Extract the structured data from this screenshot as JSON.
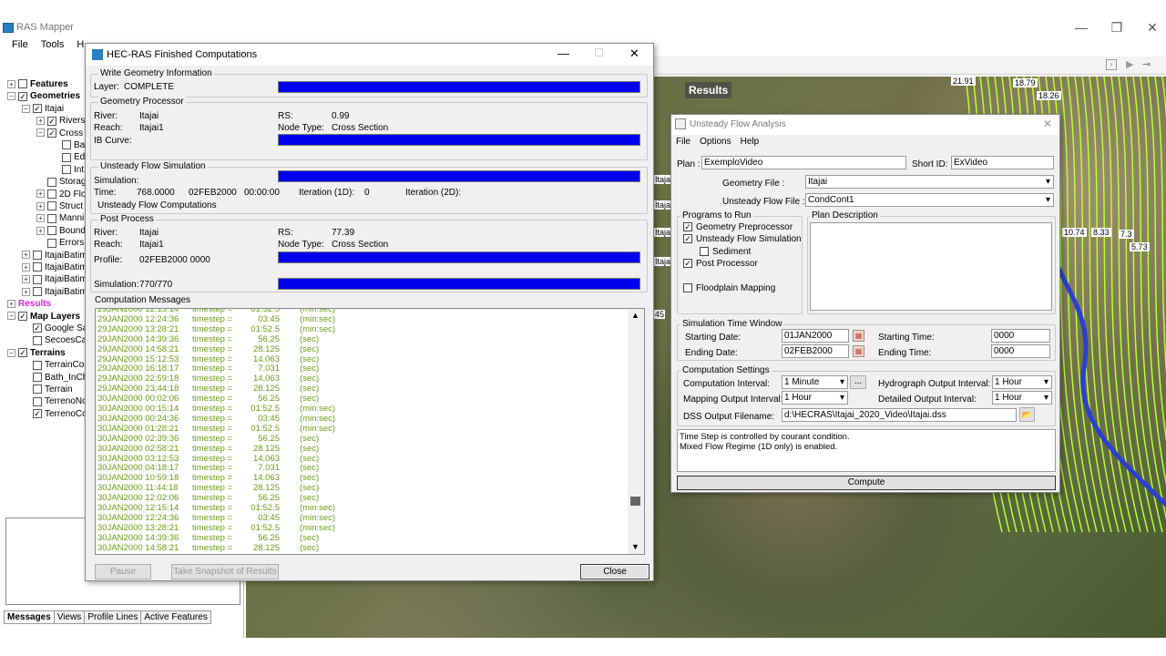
{
  "app": {
    "title": "RAS Mapper",
    "menu": [
      "File",
      "Tools",
      "H"
    ]
  },
  "tree": [
    {
      "label": "Features",
      "bold": true,
      "checked": false,
      "exp": "+",
      "indent": 0
    },
    {
      "label": "Geometries",
      "bold": true,
      "checked": true,
      "exp": "−",
      "indent": 0
    },
    {
      "label": "Itajai",
      "checked": true,
      "exp": "−",
      "indent": 1
    },
    {
      "label": "Rivers",
      "checked": true,
      "exp": "+",
      "indent": 2
    },
    {
      "label": "Cross",
      "checked": true,
      "exp": "−",
      "indent": 2
    },
    {
      "label": "Ba",
      "checked": false,
      "indent": 3
    },
    {
      "label": "Ed",
      "checked": false,
      "indent": 3
    },
    {
      "label": "Int",
      "checked": false,
      "indent": 3
    },
    {
      "label": "Storag",
      "checked": false,
      "indent": 2
    },
    {
      "label": "2D Flo",
      "checked": false,
      "exp": "+",
      "indent": 2
    },
    {
      "label": "Struct",
      "checked": false,
      "exp": "+",
      "indent": 2
    },
    {
      "label": "Manni",
      "checked": false,
      "exp": "+",
      "indent": 2
    },
    {
      "label": "Bound",
      "checked": false,
      "exp": "+",
      "indent": 2
    },
    {
      "label": "Errors",
      "checked": false,
      "indent": 2
    },
    {
      "label": "ItajaiBatim",
      "checked": false,
      "exp": "+",
      "indent": 1
    },
    {
      "label": "ItajaiBatim",
      "checked": false,
      "exp": "+",
      "indent": 1
    },
    {
      "label": "ItajaiBatim",
      "checked": false,
      "exp": "+",
      "indent": 1
    },
    {
      "label": "ItajaiBatim",
      "checked": false,
      "exp": "+",
      "indent": 1
    },
    {
      "label": "Results",
      "bold": true,
      "magenta": true,
      "exp": "+",
      "indent": 0
    },
    {
      "label": "Map Layers",
      "bold": true,
      "checked": true,
      "exp": "−",
      "indent": 0
    },
    {
      "label": "Google Sa",
      "checked": true,
      "indent": 1
    },
    {
      "label": "SecoesCa",
      "checked": false,
      "indent": 1
    },
    {
      "label": "Terrains",
      "bold": true,
      "checked": true,
      "exp": "−",
      "indent": 0
    },
    {
      "label": "TerrainCo",
      "checked": false,
      "indent": 1
    },
    {
      "label": "Bath_InCh",
      "checked": false,
      "indent": 1
    },
    {
      "label": "Terrain",
      "checked": false,
      "indent": 1
    },
    {
      "label": "TerrenoNo",
      "checked": false,
      "indent": 1
    },
    {
      "label": "TerrenoCo",
      "checked": true,
      "indent": 1
    }
  ],
  "bottom_tabs": [
    "Messages",
    "Views",
    "Profile Lines",
    "Active Features"
  ],
  "map": {
    "results_label": "Results",
    "numbers": [
      "21.91",
      "18.79",
      "18.26",
      "10.74",
      "8.33",
      "7.3",
      "5.73",
      "15.4"
    ],
    "side_labels": [
      "Itajai.p",
      "Itajai.p",
      "Itajai.p",
      "Itajai.c"
    ],
    "scroll_marker": "45"
  },
  "comp": {
    "title": "HEC-RAS Finished Computations",
    "wgi": {
      "group": "Write Geometry Information",
      "layer_lbl": "Layer:",
      "layer_val": "COMPLETE"
    },
    "gp": {
      "group": "Geometry Processor",
      "river_lbl": "River:",
      "river_val": "Itajai",
      "reach_lbl": "Reach:",
      "reach_val": "Itajai1",
      "rs_lbl": "RS:",
      "rs_val": "0.99",
      "nt_lbl": "Node Type:",
      "nt_val": "Cross Section",
      "ib_lbl": "IB Curve:"
    },
    "ufs": {
      "group": "Unsteady Flow Simulation",
      "sim_lbl": "Simulation:",
      "time_lbl": "Time:",
      "time_val": "768.0000",
      "date_val": "02FEB2000",
      "clock_val": "00:00:00",
      "iter1_lbl": "Iteration (1D):",
      "iter1_val": "0",
      "iter2_lbl": "Iteration (2D):",
      "status": "Unsteady Flow Computations"
    },
    "pp": {
      "group": "Post Process",
      "river_lbl": "River:",
      "river_val": "Itajai",
      "reach_lbl": "Reach:",
      "reach_val": "Itajai1",
      "rs_lbl": "RS:",
      "rs_val": "77.39",
      "nt_lbl": "Node Type:",
      "nt_val": "Cross Section",
      "profile_lbl": "Profile:",
      "profile_val": "02FEB2000 0000",
      "sim_lbl": "Simulation:",
      "sim_val": "770/770"
    },
    "msgs_group": "Computation Messages",
    "messages": [
      [
        "29JAN2000 12:13:14",
        "timestep =",
        "01:52.5",
        "(min:sec)"
      ],
      [
        "29JAN2000 12:24:36",
        "timestep =",
        "03:45",
        "(min:sec)"
      ],
      [
        "29JAN2000 13:28:21",
        "timestep =",
        "01:52.5",
        "(min:sec)"
      ],
      [
        "29JAN2000 14:39:36",
        "timestep =",
        "56.25",
        "(sec)"
      ],
      [
        "29JAN2000 14:58:21",
        "timestep =",
        "28.125",
        "(sec)"
      ],
      [
        "29JAN2000 15:12:53",
        "timestep =",
        "14.063",
        "(sec)"
      ],
      [
        "29JAN2000 16:18:17",
        "timestep =",
        "7.031",
        "(sec)"
      ],
      [
        "29JAN2000 22:59:18",
        "timestep =",
        "14.063",
        "(sec)"
      ],
      [
        "29JAN2000 23:44:18",
        "timestep =",
        "28.125",
        "(sec)"
      ],
      [
        "30JAN2000 00:02:06",
        "timestep =",
        "56.25",
        "(sec)"
      ],
      [
        "30JAN2000 00:15:14",
        "timestep =",
        "01:52.5",
        "(min:sec)"
      ],
      [
        "30JAN2000 00:24:36",
        "timestep =",
        "03:45",
        "(min:sec)"
      ],
      [
        "30JAN2000 01:28:21",
        "timestep =",
        "01:52.5",
        "(min:sec)"
      ],
      [
        "30JAN2000 02:39:36",
        "timestep =",
        "56.25",
        "(sec)"
      ],
      [
        "30JAN2000 02:58:21",
        "timestep =",
        "28.125",
        "(sec)"
      ],
      [
        "30JAN2000 03:12:53",
        "timestep =",
        "14.063",
        "(sec)"
      ],
      [
        "30JAN2000 04:18:17",
        "timestep =",
        "7.031",
        "(sec)"
      ],
      [
        "30JAN2000 10:59:18",
        "timestep =",
        "14.063",
        "(sec)"
      ],
      [
        "30JAN2000 11:44:18",
        "timestep =",
        "28.125",
        "(sec)"
      ],
      [
        "30JAN2000 12:02:06",
        "timestep =",
        "56.25",
        "(sec)"
      ],
      [
        "30JAN2000 12:15:14",
        "timestep =",
        "01:52.5",
        "(min:sec)"
      ],
      [
        "30JAN2000 12:24:36",
        "timestep =",
        "03:45",
        "(min:sec)"
      ],
      [
        "30JAN2000 13:28:21",
        "timestep =",
        "01:52.5",
        "(min:sec)"
      ],
      [
        "30JAN2000 14:39:36",
        "timestep =",
        "56.25",
        "(sec)"
      ],
      [
        "30JAN2000 14:58:21",
        "timestep =",
        "28.125",
        "(sec)"
      ]
    ],
    "pause": "Pause",
    "snapshot": "Take Snapshot of Results",
    "close": "Close"
  },
  "usf": {
    "title": "Unsteady Flow Analysis",
    "menu": [
      "File",
      "Options",
      "Help"
    ],
    "plan_lbl": "Plan :",
    "plan_val": "ExemploVideo",
    "short_lbl": "Short ID:",
    "short_val": "ExVideo",
    "geom_lbl": "Geometry File :",
    "geom_val": "Itajai",
    "flow_lbl": "Unsteady Flow File :",
    "flow_val": "CondCont1",
    "programs_group": "Programs to Run",
    "p1": "Geometry Preprocessor",
    "p2": "Unsteady Flow Simulation",
    "p3": "Sediment",
    "p4": "Post Processor",
    "p5": "Floodplain Mapping",
    "desc_group": "Plan Description",
    "stw_group": "Simulation Time Window",
    "sd_lbl": "Starting Date:",
    "sd_val": "01JAN2000",
    "ed_lbl": "Ending Date:",
    "ed_val": "02FEB2000",
    "st_lbl": "Starting Time:",
    "st_val": "0000",
    "et_lbl": "Ending Time:",
    "et_val": "0000",
    "cs_group": "Computation Settings",
    "ci_lbl": "Computation Interval:",
    "ci_val": "1 Minute",
    "hoi_lbl": "Hydrograph Output Interval:",
    "hoi_val": "1 Hour",
    "moi_lbl": "Mapping Output Interval:",
    "moi_val": "1 Hour",
    "doi_lbl": "Detailed Output Interval:",
    "doi_val": "1 Hour",
    "dss_lbl": "DSS Output Filename:",
    "dss_val": "d:\\HECRAS\\Itajai_2020_Video\\Itajai.dss",
    "info1": "Time Step is controlled by courant condition.",
    "info2": "Mixed Flow Regime (1D only) is enabled.",
    "compute": "Compute"
  }
}
